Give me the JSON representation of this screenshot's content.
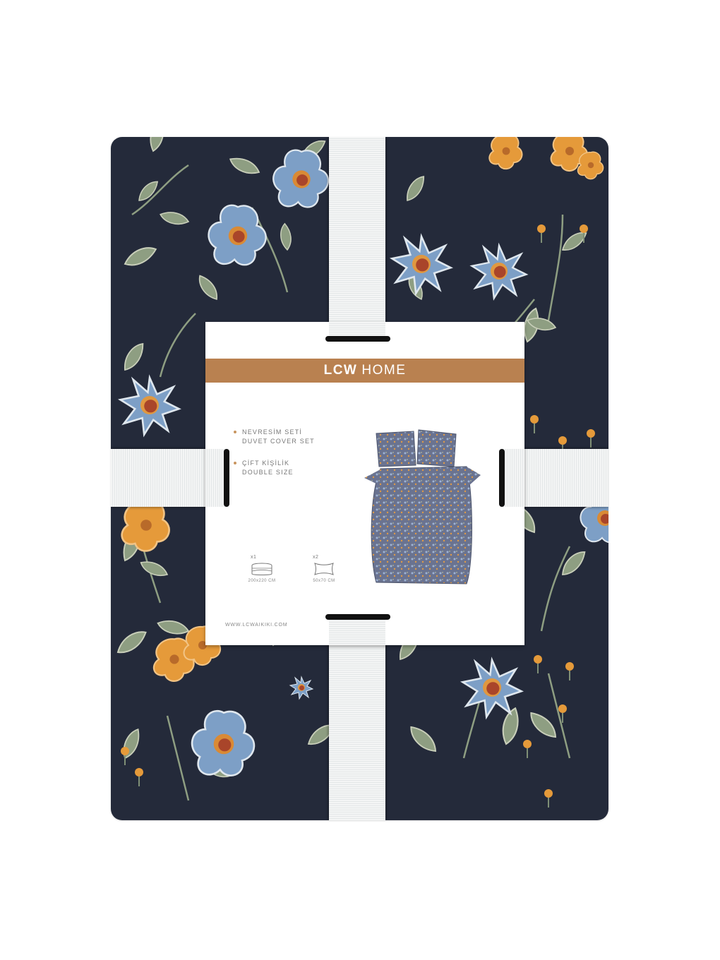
{
  "brand": {
    "bold": "LCW",
    "light": "HOME"
  },
  "product": {
    "line1_tr": "NEVRESİM SETİ",
    "line1_en": "DUVET COVER SET",
    "line2_tr": "ÇİFT KİŞİLİK",
    "line2_en": "DOUBLE SIZE"
  },
  "contents": [
    {
      "count": "x1",
      "size": "200x220 CM",
      "icon": "duvet-icon"
    },
    {
      "count": "x2",
      "size": "50x70 CM",
      "icon": "pillow-icon"
    }
  ],
  "website": "WWW.LCWAIKIKI.COM",
  "colors": {
    "fabric_background": "#242a3a",
    "brand_bar": "#b98150",
    "flower_blue": "#7d9fc6",
    "flower_orange": "#e59a3a",
    "leaf_green": "#8e9e82"
  }
}
